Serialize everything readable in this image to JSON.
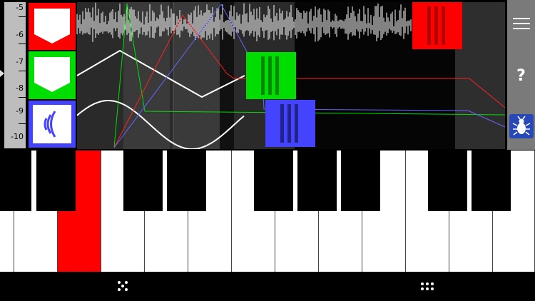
{
  "ruler": {
    "labels": [
      "-5",
      "-6",
      "-7",
      "-8",
      "-9",
      "-10"
    ]
  },
  "tracks": [
    {
      "name": "red",
      "color": "#ff0000",
      "icon": "shield-icon",
      "block_color": "#ff0000"
    },
    {
      "name": "green",
      "color": "#00dd00",
      "icon": "shield-icon",
      "block_color": "#00dd00"
    },
    {
      "name": "blue",
      "color": "#4444ff",
      "icon": "wave-icon",
      "block_color": "#4444ff"
    }
  ],
  "side": {
    "help_label": "?"
  },
  "keyboard": {
    "pressed_white_key_index": 2,
    "pressed_color": "#ff0000"
  }
}
